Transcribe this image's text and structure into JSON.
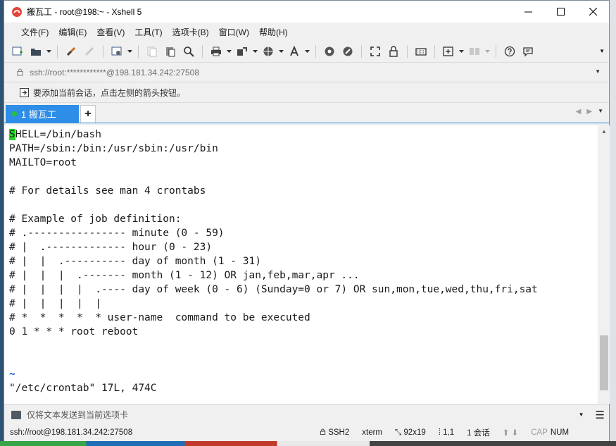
{
  "window": {
    "title": "搬瓦工 - root@198:~ - Xshell 5"
  },
  "menu": [
    "文件(F)",
    "编辑(E)",
    "查看(V)",
    "工具(T)",
    "选项卡(B)",
    "窗口(W)",
    "帮助(H)"
  ],
  "address": {
    "value": "ssh://root:************@198.181.34.242:27508"
  },
  "linkbar": {
    "hint": "要添加当前会话，点击左侧的箭头按钮。"
  },
  "tabs": {
    "active_label": "1 搬瓦工",
    "add_label": "+"
  },
  "terminal": {
    "cursor_char": "S",
    "lines": [
      "HELL=/bin/bash",
      "PATH=/sbin:/bin:/usr/sbin:/usr/bin",
      "MAILTO=root",
      "",
      "# For details see man 4 crontabs",
      "",
      "# Example of job definition:",
      "# .---------------- minute (0 - 59)",
      "# |  .------------- hour (0 - 23)",
      "# |  |  .---------- day of month (1 - 31)",
      "# |  |  |  .------- month (1 - 12) OR jan,feb,mar,apr ...",
      "# |  |  |  |  .---- day of week (0 - 6) (Sunday=0 or 7) OR sun,mon,tue,wed,thu,fri,sat",
      "# |  |  |  |  |",
      "# *  *  *  *  * user-name  command to be executed",
      "0 1 * * * root reboot",
      "",
      "",
      "~",
      "\"/etc/crontab\" 17L, 474C"
    ]
  },
  "compose": {
    "placeholder": "仅将文本发送到当前选项卡"
  },
  "status": {
    "connection": "ssh://root@198.181.34.242:27508",
    "protocol": "SSH2",
    "terminal_type": "xterm",
    "size": "92x19",
    "cursor_pos": "1,1",
    "sessions": "1 会话",
    "caps": "CAP",
    "num": "NUM"
  },
  "colors": {
    "tab_active": "#2e8de6",
    "cursor": "#25d825",
    "tilde": "#1858c0"
  }
}
